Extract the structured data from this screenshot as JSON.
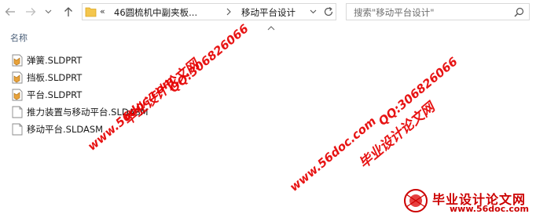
{
  "breadcrumb": {
    "overflow_glyph": "«",
    "parent": "46圆梳机中副夹板...",
    "current": "移动平台设计"
  },
  "search": {
    "placeholder": "搜索\"移动平台设计\""
  },
  "columns": {
    "name": "名称"
  },
  "files": [
    {
      "name": "弹簧.SLDPRT",
      "icon": "sldprt-icon"
    },
    {
      "name": "挡板.SLDPRT",
      "icon": "sldprt-icon"
    },
    {
      "name": "平台.SLDPRT",
      "icon": "sldprt-icon"
    },
    {
      "name": "推力装置与移动平台.SLDASM",
      "icon": "sldasm-icon"
    },
    {
      "name": "移动平台.SLDASM",
      "icon": "sldasm-icon"
    }
  ],
  "watermark": {
    "cn": "毕业设计论文网",
    "site": "www.56doc.com",
    "qq": "QQ:306826066",
    "brand_title": "毕业设计论文网",
    "brand_url": "www.56doc.com"
  },
  "colors": {
    "watermark": "#e60000",
    "folder": "#f4c64d"
  }
}
